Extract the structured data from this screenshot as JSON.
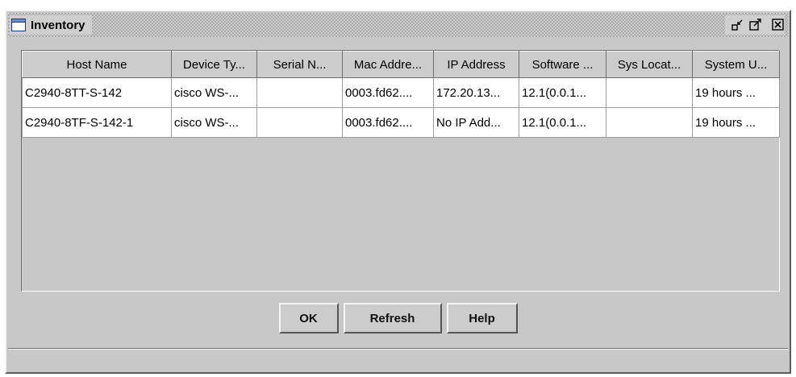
{
  "window": {
    "title": "Inventory"
  },
  "table": {
    "columns": [
      "Host Name",
      "Device Ty...",
      "Serial N...",
      "Mac Addre...",
      "IP Address",
      "Software ...",
      "Sys Locat...",
      "System U..."
    ],
    "rows": [
      [
        "C2940-8TT-S-142",
        "cisco WS-...",
        "",
        "0003.fd62....",
        "172.20.13...",
        "12.1(0.0.1...",
        "",
        "19 hours ..."
      ],
      [
        "C2940-8TF-S-142-1",
        "cisco WS-...",
        "",
        "0003.fd62....",
        "No IP Add...",
        "12.1(0.0.1...",
        "",
        "19 hours ..."
      ]
    ]
  },
  "buttons": {
    "ok": "OK",
    "refresh": "Refresh",
    "help": "Help"
  },
  "icons": {
    "app": "window-icon",
    "minimize": "minimize-icon",
    "maximize": "maximize-icon",
    "close": "close-icon"
  }
}
